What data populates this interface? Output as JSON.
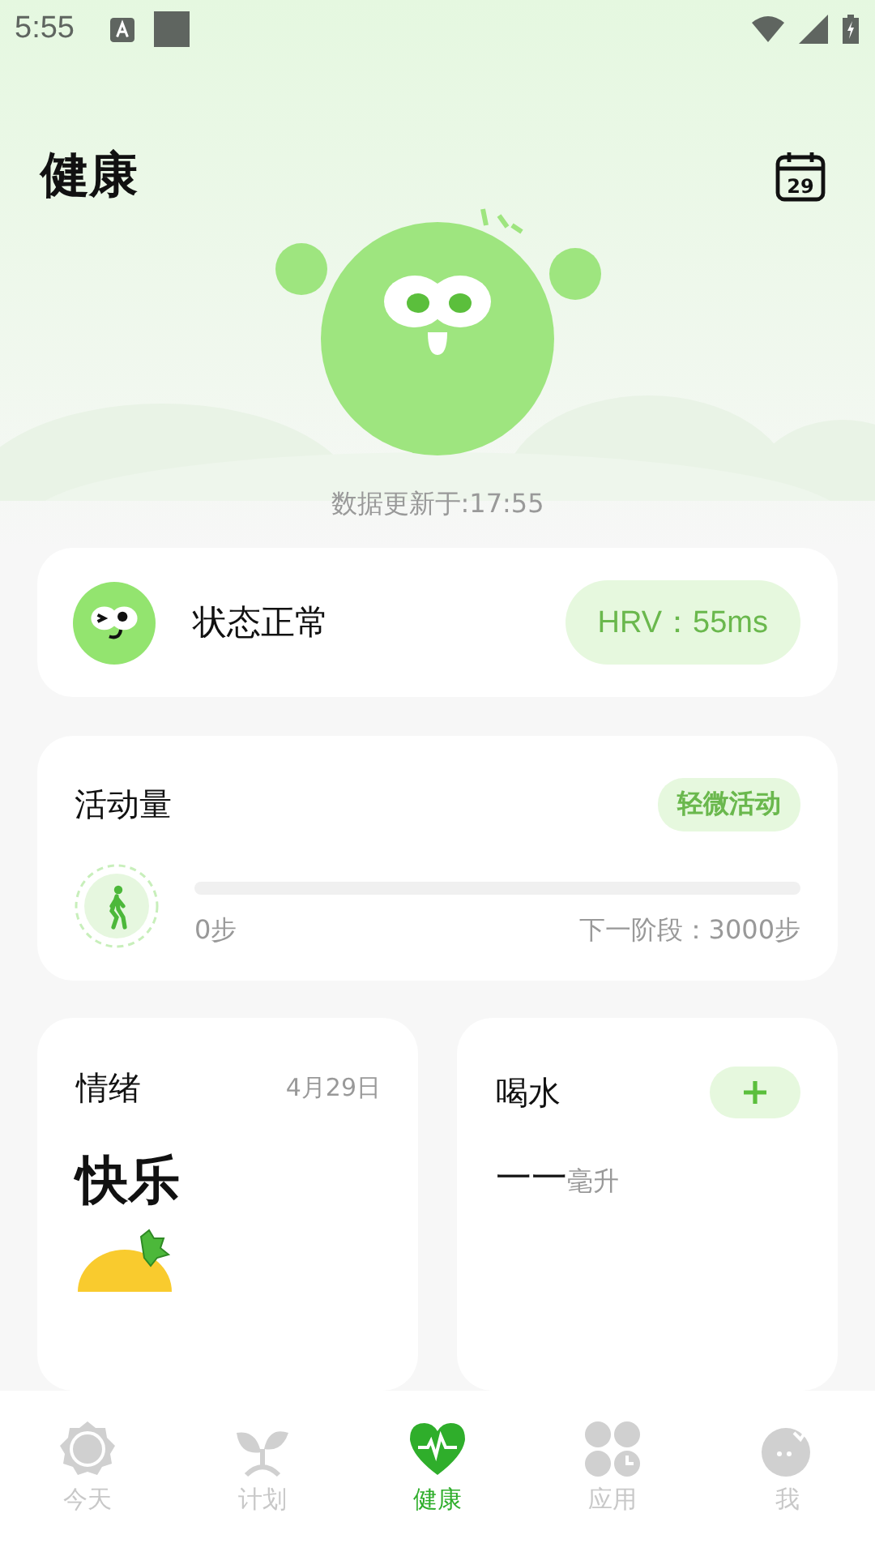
{
  "status_bar": {
    "time": "5:55"
  },
  "header": {
    "title": "健康",
    "calendar_day": "29"
  },
  "update_text": "数据更新于:17:55",
  "status_card": {
    "label": "状态正常",
    "hrv": "HRV：55ms"
  },
  "activity": {
    "title": "活动量",
    "badge": "轻微活动",
    "level": 0,
    "steps": "0步",
    "next_stage": "下一阶段：3000步"
  },
  "mood": {
    "title": "情绪",
    "date": "4月29日",
    "value": "快乐"
  },
  "water": {
    "title": "喝水",
    "amount": "一一",
    "unit": "毫升"
  },
  "nav": [
    {
      "kind": "today",
      "label": "今天",
      "selected": false
    },
    {
      "kind": "plan",
      "label": "计划",
      "selected": false
    },
    {
      "kind": "health",
      "label": "健康",
      "selected": true
    },
    {
      "kind": "apps",
      "label": "应用",
      "selected": false
    },
    {
      "kind": "me",
      "label": "我",
      "selected": false
    }
  ]
}
